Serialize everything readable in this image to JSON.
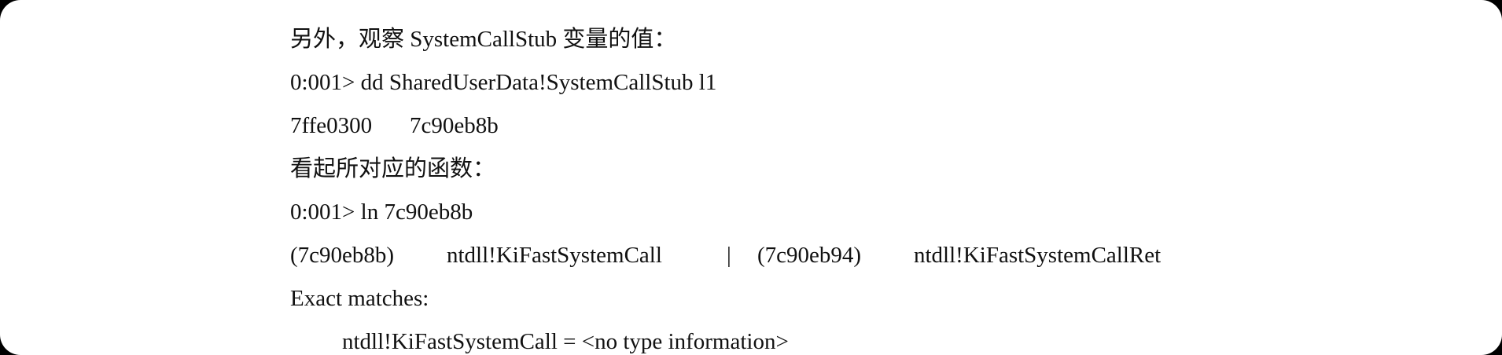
{
  "document": {
    "lines": [
      "另外，观察 SystemCallStub 变量的值：",
      "0:001> dd SharedUserData!SystemCallStub l1",
      "看起所对应的函数：",
      "0:001> ln 7c90eb8b",
      "Exact matches:",
      "ntdll!KiFastSystemCall = <no type information>"
    ],
    "dump_row": {
      "address": "7ffe0300",
      "value": "7c90eb8b"
    },
    "ln_row": {
      "addr1": "(7c90eb8b)",
      "sym1": "ntdll!KiFastSystemCall",
      "sep": "|",
      "addr2": "(7c90eb94)",
      "sym2": "ntdll!KiFastSystemCallRet"
    }
  },
  "colors": {
    "text": "#111111",
    "page": "#ffffff",
    "border": "#000000"
  }
}
